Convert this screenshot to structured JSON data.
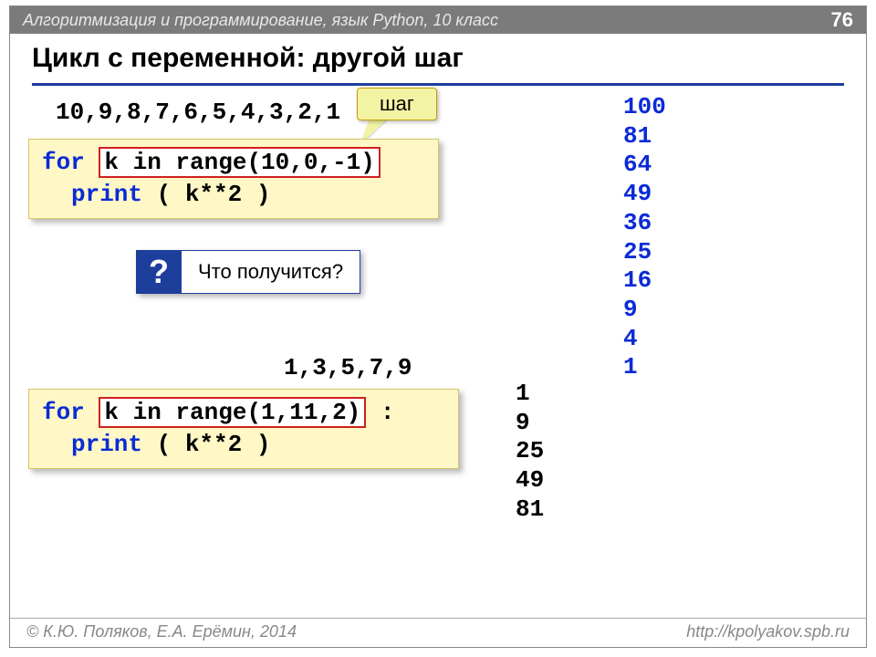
{
  "header": {
    "course": "Алгоритмизация и программирование, язык Python, 10 класс",
    "page": "76"
  },
  "title": "Цикл с переменной: другой шаг",
  "seq1": "10,9,8,7,6,5,4,3,2,1",
  "step_label": "шаг",
  "code1": {
    "for": "for",
    "inrange": "k in range(10,0,-1)",
    "print": "print",
    "expr": " ( k**2 )"
  },
  "question": "Что получится?",
  "seq2": "1,3,5,7,9",
  "code2": {
    "for": "for",
    "inrange": "k in range(1,11,2)",
    "colon": " :",
    "print": "print",
    "expr": " ( k**2 )"
  },
  "output1": [
    "100",
    "81",
    "64",
    "49",
    "36",
    "25",
    "16",
    "9",
    "4",
    "1"
  ],
  "output2": [
    "1",
    "9",
    "25",
    "49",
    "81"
  ],
  "footer": {
    "left": "© К.Ю. Поляков, Е.А. Ерёмин, 2014",
    "right": "http://kpolyakov.spb.ru"
  }
}
